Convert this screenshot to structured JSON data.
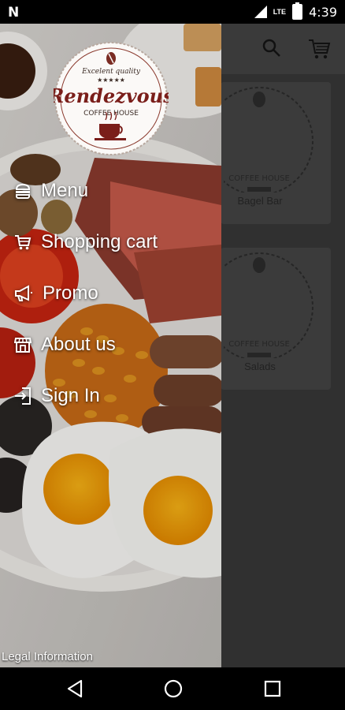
{
  "status_bar": {
    "carrier_icon": "n-notification-icon",
    "network": "LTE",
    "time": "4:39"
  },
  "background_screen": {
    "toolbar": {
      "search_icon": "search-icon",
      "cart_icon": "cart-icon"
    },
    "categories": [
      {
        "label": "Bagel Bar"
      },
      {
        "label": "Salads"
      }
    ]
  },
  "drawer": {
    "logo": {
      "top_text": "Excelent quality",
      "stars": "★★★★★",
      "brand": "Rendezvous",
      "subtitle": "COFFEE HOUSE"
    },
    "menu": [
      {
        "label": "Menu",
        "icon": "burger-icon"
      },
      {
        "label": "Shopping cart",
        "icon": "cart-icon"
      },
      {
        "label": "Promo",
        "icon": "megaphone-icon"
      },
      {
        "label": "About us",
        "icon": "store-icon"
      },
      {
        "label": "Sign In",
        "icon": "sign-in-icon"
      }
    ],
    "legal_link": "Legal Information"
  },
  "nav_bar": {
    "back": "back-icon",
    "home": "home-icon",
    "recents": "recents-icon"
  }
}
